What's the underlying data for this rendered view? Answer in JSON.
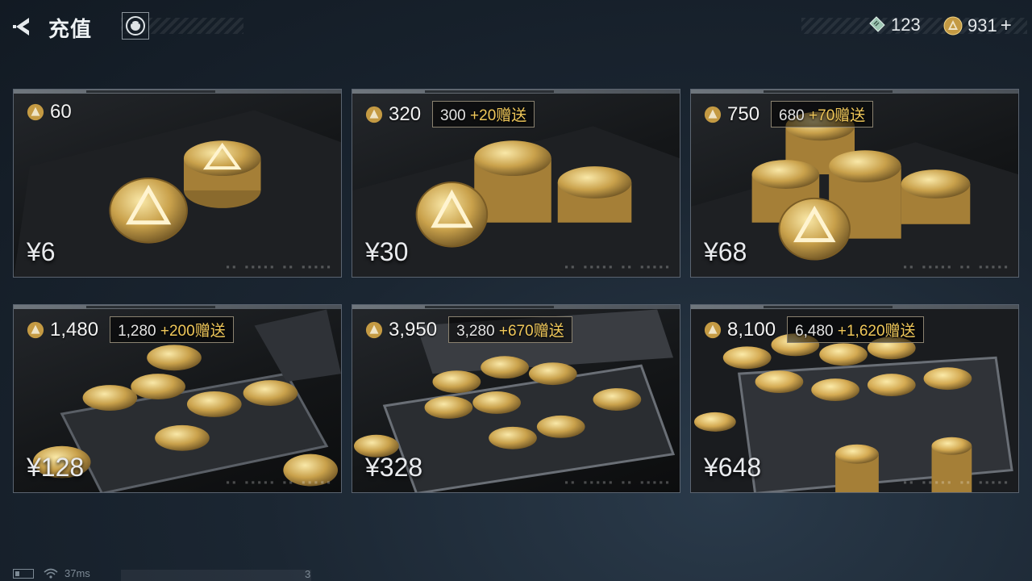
{
  "header": {
    "title": "充值",
    "ticket_balance": "123",
    "coin_balance": "931",
    "plus_label": "+"
  },
  "packages": [
    {
      "amount": "60",
      "base": "",
      "bonus": "",
      "bonus_suffix": "",
      "price": "¥6"
    },
    {
      "amount": "320",
      "base": "300",
      "bonus": "+20",
      "bonus_suffix": "赠送",
      "price": "¥30"
    },
    {
      "amount": "750",
      "base": "680",
      "bonus": "+70",
      "bonus_suffix": "赠送",
      "price": "¥68"
    },
    {
      "amount": "1,480",
      "base": "1,280",
      "bonus": "+200",
      "bonus_suffix": "赠送",
      "price": "¥128"
    },
    {
      "amount": "3,950",
      "base": "3,280",
      "bonus": "+670",
      "bonus_suffix": "赠送",
      "price": "¥328"
    },
    {
      "amount": "8,100",
      "base": "6,480",
      "bonus": "+1,620",
      "bonus_suffix": "赠送",
      "price": "¥648"
    }
  ],
  "status": {
    "ping": "37ms",
    "counter": "3"
  },
  "colors": {
    "accent_gold": "#f0c85a",
    "card_border": "#5b6470"
  },
  "icons": [
    "back-arrow-icon",
    "support-icon",
    "ticket-icon",
    "coin-icon",
    "battery-icon",
    "wifi-icon"
  ]
}
